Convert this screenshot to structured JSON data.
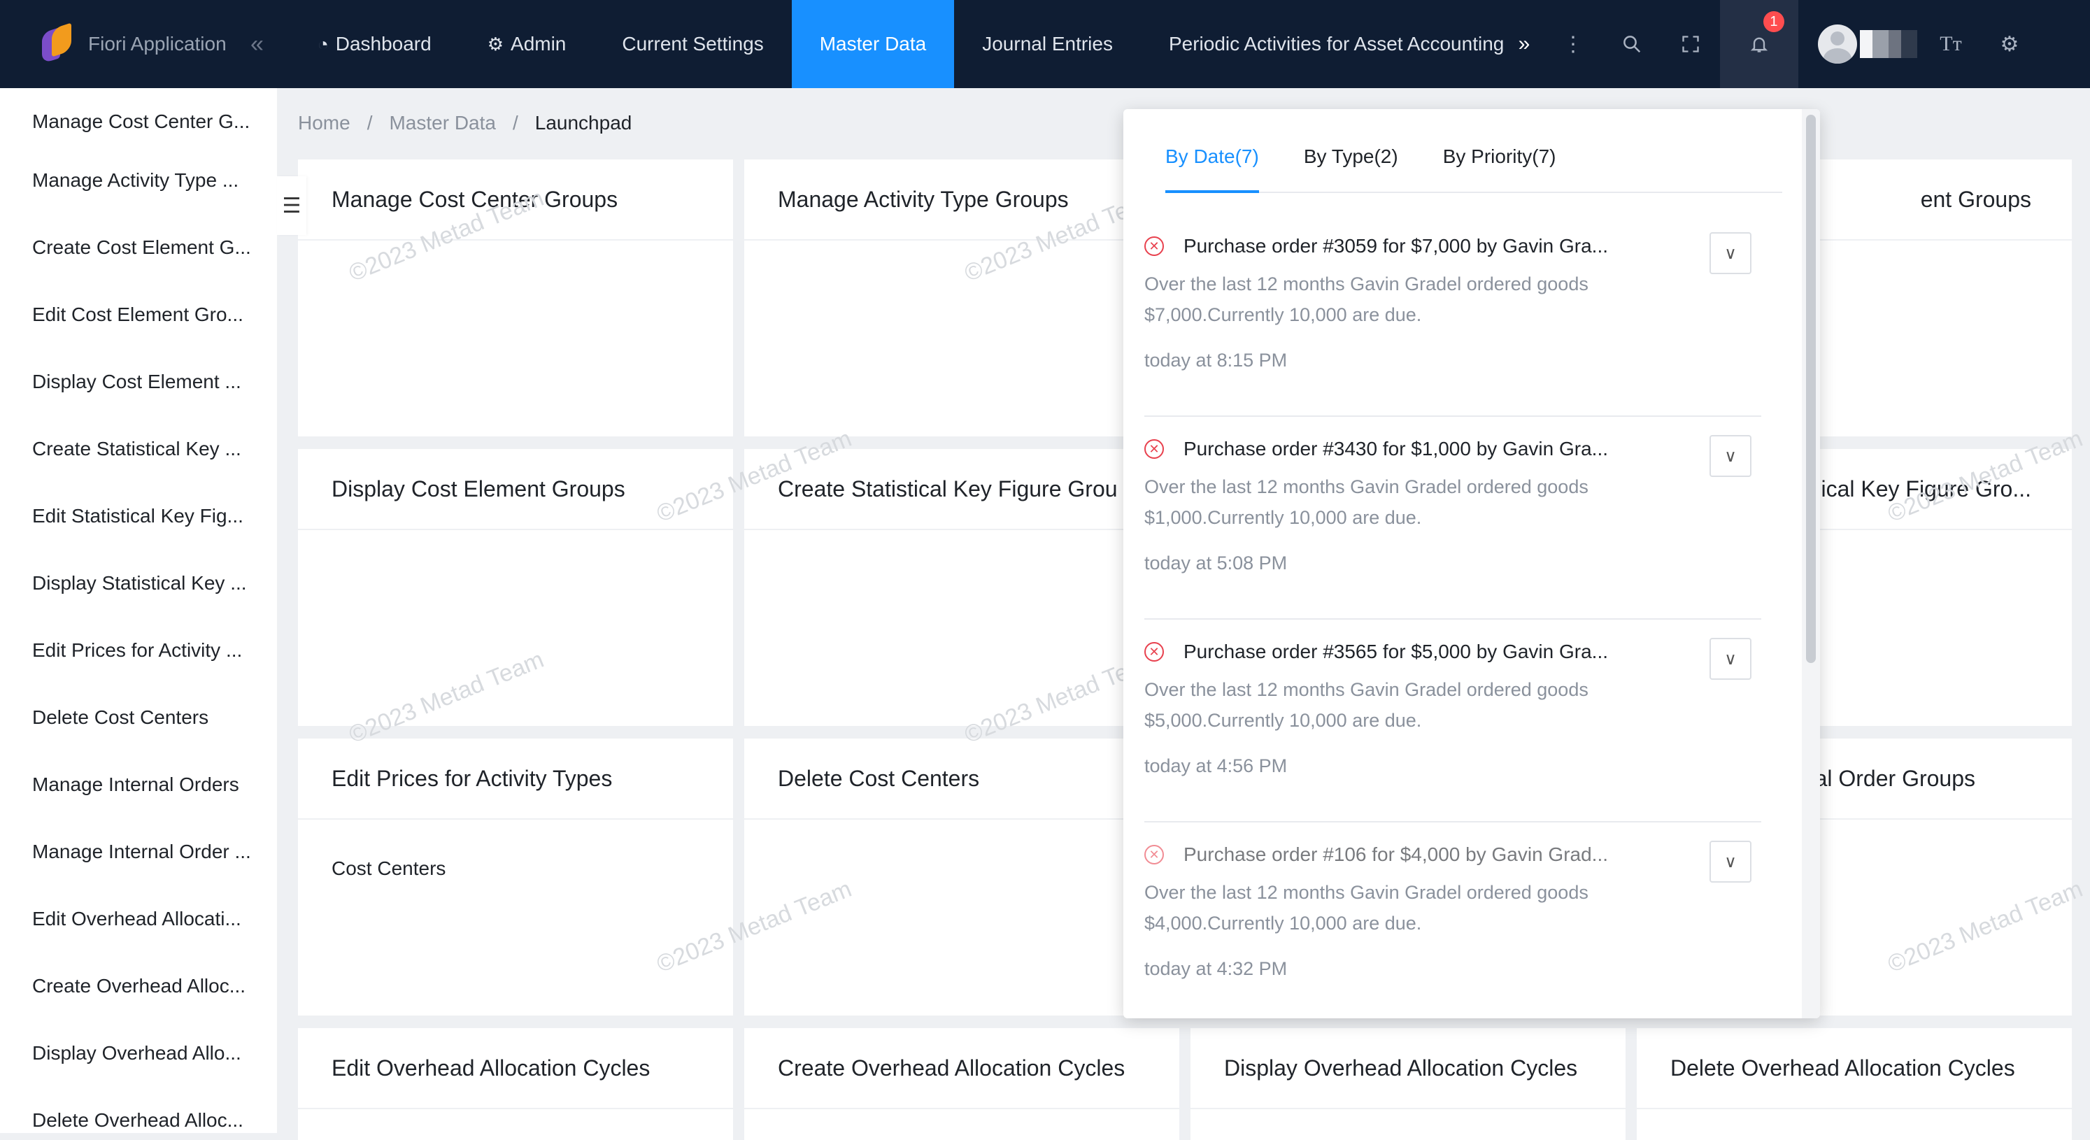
{
  "header": {
    "app_title": "Fiori Application",
    "nav": [
      {
        "label": "Dashboard",
        "icon": "dashboard-icon"
      },
      {
        "label": "Admin",
        "icon": "gear-icon"
      },
      {
        "label": "Current Settings"
      },
      {
        "label": "Master Data",
        "active": true
      },
      {
        "label": "Journal Entries"
      },
      {
        "label": "Periodic Activities for Asset Accounting"
      }
    ],
    "notification_count": "1"
  },
  "sidebar": {
    "items": [
      "Manage Cost Center G...",
      "Manage Activity Type ...",
      "Create Cost Element G...",
      "Edit Cost Element Gro...",
      "Display Cost Element ...",
      "Create Statistical Key ...",
      "Edit Statistical Key Fig...",
      "Display Statistical Key ...",
      "Edit Prices for Activity ...",
      "Delete Cost Centers",
      "Manage Internal Orders",
      "Manage Internal Order ...",
      "Edit Overhead Allocati...",
      "Create Overhead Alloc...",
      "Display Overhead Allo...",
      "Delete Overhead Alloc..."
    ]
  },
  "breadcrumb": {
    "home": "Home",
    "section": "Master Data",
    "current": "Launchpad"
  },
  "tiles": {
    "r1c1": "Manage Cost Center Groups",
    "r1c2": "Manage Activity Type Groups",
    "r1c4": "ent Groups",
    "r2c1": "Display Cost Element Groups",
    "r2c2": "Create Statistical Key Figure Grou",
    "r2c4": "ical Key Figure Gro...",
    "r3c1": "Edit Prices for Activity Types",
    "r3c1_body": "Cost Centers",
    "r3c2": "Delete Cost Centers",
    "r3c4": "al Order Groups",
    "r4c1": "Edit Overhead Allocation Cycles",
    "r4c2": "Create Overhead Allocation Cycles",
    "r4c3": "Display Overhead Allocation Cycles",
    "r4c4": "Delete Overhead Allocation Cycles"
  },
  "watermark": "©2023 Metad Team",
  "notifications": {
    "tabs": [
      "By Date(7)",
      "By Type(2)",
      "By Priority(7)"
    ],
    "items": [
      {
        "title": "Purchase order #3059 for $7,000 by Gavin Gra...",
        "desc": "Over the last 12 months Gavin Gradel ordered goods $7,000.Currently 10,000 are due.",
        "time": "today at 8:15 PM"
      },
      {
        "title": "Purchase order #3430 for $1,000 by Gavin Gra...",
        "desc": "Over the last 12 months Gavin Gradel ordered goods $1,000.Currently 10,000 are due.",
        "time": "today at 5:08 PM"
      },
      {
        "title": "Purchase order #3565 for $5,000 by Gavin Gra...",
        "desc": "Over the last 12 months Gavin Gradel ordered goods $5,000.Currently 10,000 are due.",
        "time": "today at 4:56 PM"
      },
      {
        "title": "Purchase order #106 for $4,000 by Gavin Grad...",
        "desc": "Over the last 12 months Gavin Gradel ordered goods $4,000.Currently 10,000 are due.",
        "time": "today at 4:32 PM"
      }
    ]
  },
  "colors": {
    "topbar": "#0f1d33",
    "accent": "#1890ff",
    "error": "#e8414e"
  }
}
